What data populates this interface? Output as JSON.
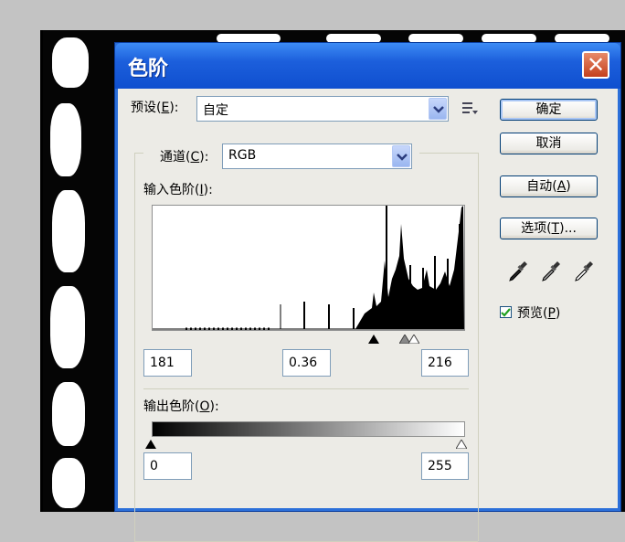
{
  "dialog": {
    "title": "色阶",
    "close_glyph": "✕"
  },
  "preset": {
    "label_prefix": "预设(",
    "label_key": "E",
    "label_suffix": "):",
    "value": "自定"
  },
  "channel": {
    "label_prefix": "通道(",
    "label_key": "C",
    "label_suffix": "):",
    "value": "RGB"
  },
  "input_levels": {
    "label_prefix": "输入色阶(",
    "label_key": "I",
    "label_suffix": "):",
    "black": "181",
    "gamma": "0.36",
    "white": "216"
  },
  "output_levels": {
    "label_prefix": "输出色阶(",
    "label_key": "O",
    "label_suffix": "):",
    "black": "0",
    "white": "255"
  },
  "buttons": {
    "ok": "确定",
    "cancel": "取消",
    "auto_prefix": "自动(",
    "auto_key": "A",
    "auto_suffix": ")",
    "options_prefix": "选项(",
    "options_key": "T",
    "options_suffix": ")..."
  },
  "preview": {
    "label_prefix": "预览(",
    "label_key": "P",
    "label_suffix": ")",
    "checked": true
  },
  "icons": [
    "close-icon",
    "dropdown-arrow-icon",
    "preset-options-icon",
    "black-eyedropper-icon",
    "gray-eyedropper-icon",
    "white-eyedropper-icon",
    "checkmark-icon",
    "black-point-slider-icon",
    "gamma-slider-icon",
    "white-point-slider-icon"
  ],
  "colors": {
    "titlebar": "#1c5fdc",
    "close_button": "#c4401d",
    "dialog_bg": "#ecebe6"
  }
}
